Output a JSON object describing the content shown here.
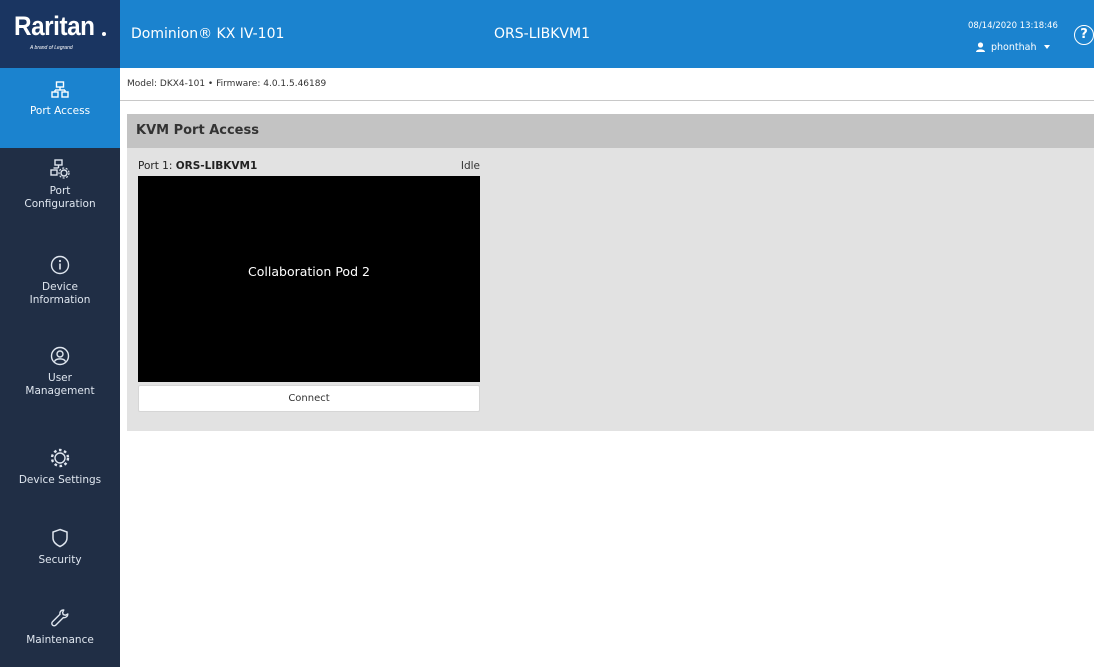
{
  "brand": {
    "logo_text": "Raritan",
    "tagline": "A brand of Legrand"
  },
  "header": {
    "product": "Dominion® KX IV-101",
    "device_name": "ORS-LIBKVM1",
    "datetime": "08/14/2020 13:18:46",
    "username": "phonthah",
    "help_label": "?"
  },
  "sidebar": {
    "items": [
      {
        "label": "Port Access",
        "icon": "network-icon",
        "active": true
      },
      {
        "label": "Port Configuration",
        "icon": "port-config-icon",
        "active": false
      },
      {
        "label": "Device Information",
        "icon": "info-icon",
        "active": false
      },
      {
        "label": "User Management",
        "icon": "user-icon",
        "active": false
      },
      {
        "label": "Device Settings",
        "icon": "gear-icon",
        "active": false
      },
      {
        "label": "Security",
        "icon": "shield-icon",
        "active": false
      },
      {
        "label": "Maintenance",
        "icon": "wrench-icon",
        "active": false
      }
    ]
  },
  "meta": {
    "text": "Model: DKX4-101  •  Firmware: 4.0.1.5.46189"
  },
  "panel": {
    "title": "KVM Port Access"
  },
  "port": {
    "prefix": "Port 1: ",
    "name": "ORS-LIBKVM1",
    "status": "Idle",
    "preview_label": "Collaboration Pod 2",
    "connect_label": "Connect"
  },
  "colors": {
    "header_blue": "#1b83cf",
    "sidebar_navy": "#202e45",
    "logo_navy": "#1a3561"
  }
}
